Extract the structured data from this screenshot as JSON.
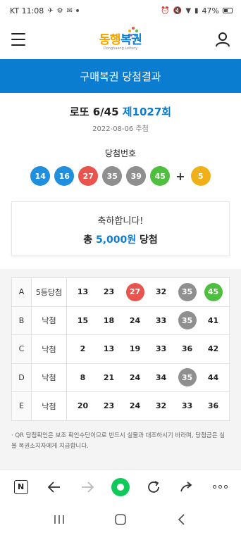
{
  "status_bar": {
    "carrier_time": "KT 11:08",
    "battery_pct": "47%"
  },
  "header": {
    "logo_text_1": "동행",
    "logo_text_2": "복권",
    "logo_sub": "Donghaeng Lottery"
  },
  "banner": {
    "title": "구매복권 당첨결과"
  },
  "draw": {
    "game": "로또 6/45",
    "round": "제1027회",
    "date": "2022-08-06 추첨",
    "win_label": "당첨번호",
    "numbers": [
      "14",
      "16",
      "27",
      "35",
      "39",
      "45"
    ],
    "plus": "+",
    "bonus": "5",
    "ball_colors": [
      "#1f8fde",
      "#1f8fde",
      "#e8544e",
      "#8f8f8f",
      "#8f8f8f",
      "#4fbf3f"
    ],
    "bonus_color": "#f0b01a"
  },
  "result": {
    "line1": "축하합니다!",
    "prefix": "총 ",
    "amount": "5,000원",
    "suffix": " 당첨"
  },
  "games": [
    {
      "letter": "A",
      "rank": "5등당첨",
      "nums": [
        "13",
        "23",
        "27",
        "32",
        "35",
        "45"
      ],
      "hits": [
        false,
        false,
        true,
        false,
        true,
        true
      ]
    },
    {
      "letter": "B",
      "rank": "낙첨",
      "nums": [
        "15",
        "18",
        "24",
        "33",
        "35",
        "41"
      ],
      "hits": [
        false,
        false,
        false,
        false,
        true,
        false
      ]
    },
    {
      "letter": "C",
      "rank": "낙첨",
      "nums": [
        "2",
        "13",
        "19",
        "33",
        "36",
        "42"
      ],
      "hits": [
        false,
        false,
        false,
        false,
        false,
        false
      ]
    },
    {
      "letter": "D",
      "rank": "낙첨",
      "nums": [
        "8",
        "21",
        "24",
        "34",
        "35",
        "44"
      ],
      "hits": [
        false,
        false,
        false,
        false,
        true,
        false
      ]
    },
    {
      "letter": "E",
      "rank": "낙첨",
      "nums": [
        "20",
        "23",
        "24",
        "32",
        "33",
        "36"
      ],
      "hits": [
        false,
        false,
        false,
        false,
        false,
        false
      ]
    }
  ],
  "hit_colors": {
    "27": "#e8544e",
    "35": "#8f8f8f",
    "45": "#4fbf3f"
  },
  "note": "· QR 당첨확인은 보조 확인수단이므로 반드시 실물과 대조하시기 바라며, 당첨금은 실물 복권소지자에게 지급합니다.",
  "browser": {
    "n_label": "N"
  },
  "colors": {
    "primary": "#0b7dd0",
    "accent_green": "#11c85a"
  }
}
